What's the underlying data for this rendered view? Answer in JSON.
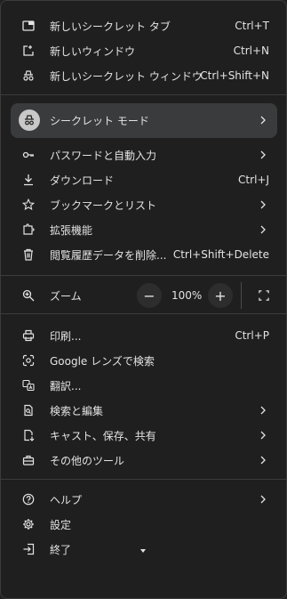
{
  "menu": {
    "new_incognito_tab": {
      "label": "新しいシークレット タブ",
      "shortcut": "Ctrl+T",
      "icon": "new-tab-icon"
    },
    "new_window": {
      "label": "新しいウィンドウ",
      "shortcut": "Ctrl+N",
      "icon": "new-window-icon"
    },
    "new_incognito_window": {
      "label": "新しいシークレット ウィンドウ",
      "shortcut": "Ctrl+Shift+N",
      "icon": "incognito-icon"
    },
    "incognito_mode": {
      "label": "シークレット モード",
      "icon": "incognito-avatar-icon"
    },
    "passwords": {
      "label": "パスワードと自動入力",
      "icon": "key-icon"
    },
    "downloads": {
      "label": "ダウンロード",
      "shortcut": "Ctrl+J",
      "icon": "download-icon"
    },
    "bookmarks": {
      "label": "ブックマークとリスト",
      "icon": "star-icon"
    },
    "extensions": {
      "label": "拡張機能",
      "icon": "extension-icon"
    },
    "clear_data": {
      "label": "閲覧履歴データを削除...",
      "shortcut": "Ctrl+Shift+Delete",
      "icon": "trash-icon"
    },
    "zoom": {
      "label": "ズーム",
      "value": "100%",
      "minus": "−",
      "plus": "+",
      "icon": "zoom-icon"
    },
    "print": {
      "label": "印刷...",
      "shortcut": "Ctrl+P",
      "icon": "print-icon"
    },
    "lens": {
      "label": "Google レンズで検索",
      "icon": "lens-icon"
    },
    "translate": {
      "label": "翻訳...",
      "icon": "translate-icon"
    },
    "find_edit": {
      "label": "検索と編集",
      "icon": "find-icon"
    },
    "cast_save_share": {
      "label": "キャスト、保存、共有",
      "icon": "cast-save-icon"
    },
    "more_tools": {
      "label": "その他のツール",
      "icon": "toolbox-icon"
    },
    "help": {
      "label": "ヘルプ",
      "icon": "help-icon"
    },
    "settings": {
      "label": "設定",
      "icon": "gear-icon"
    },
    "exit": {
      "label": "終了",
      "icon": "exit-icon"
    }
  },
  "colors": {
    "background": "#1f1f1f",
    "highlight": "#3a3b3d",
    "text": "#e3e3e3",
    "separator": "#3c3c3c"
  }
}
